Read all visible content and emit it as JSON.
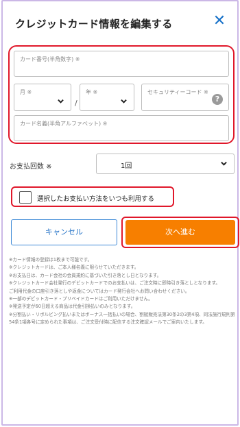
{
  "header": {
    "title": "クレジットカード情報を編集する",
    "close_icon": "close-icon"
  },
  "card_form": {
    "card_number_label": "カード番号(半角数字) ※",
    "card_number_value": "",
    "month_label": "月 ※",
    "month_value": "",
    "separator": "/",
    "year_label": "年 ※",
    "year_value": "",
    "security_code_label": "セキュリティーコード ※",
    "security_code_value": "",
    "help_icon": "help-icon",
    "help_glyph": "?",
    "cardholder_name_label": "カード名義(半角アルファベット) ※",
    "cardholder_name_value": ""
  },
  "payment": {
    "installments_label": "お支払回数 ※",
    "installments_selected": "1回"
  },
  "save_method": {
    "checked": false,
    "label": "選択したお支払い方法をいつも利用する"
  },
  "actions": {
    "cancel_label": "キャンセル",
    "next_label": "次へ進む"
  },
  "notes": [
    "※カード情報の登録は1枚まで可能です。",
    "※クレジットカードは、ご本人様名義に限らせていただきます。",
    "※お支払日は、カード会社の会員規約に基づいた引き落とし日となります。",
    "※クレジットカード会社発行のデビットカードでのお支払いは、ご注文時に即時引き落としとなります。",
    "ご利用代金の口座引き落としや返金についてはカード発行会社へお問い合わせください。",
    "※一部のデビットカード・プリペイドカードはご利用いただけません。",
    "※発送予定が60日超える商品は代金引換払いのみとなります。",
    "※分割払い・リボルビング払いまたはボーナス一括払いの場合、割賦販売法第30条2の3第4項、同法施行規則第54条1項各号に定められた事項は、ご注文受付時に配信する注文確認メールでご案内いたします。"
  ],
  "colors": {
    "accent_blue": "#1a73c9",
    "button_orange": "#f77f00",
    "highlight_red": "#e0172a",
    "frame_purple": "#cbb7e6"
  }
}
